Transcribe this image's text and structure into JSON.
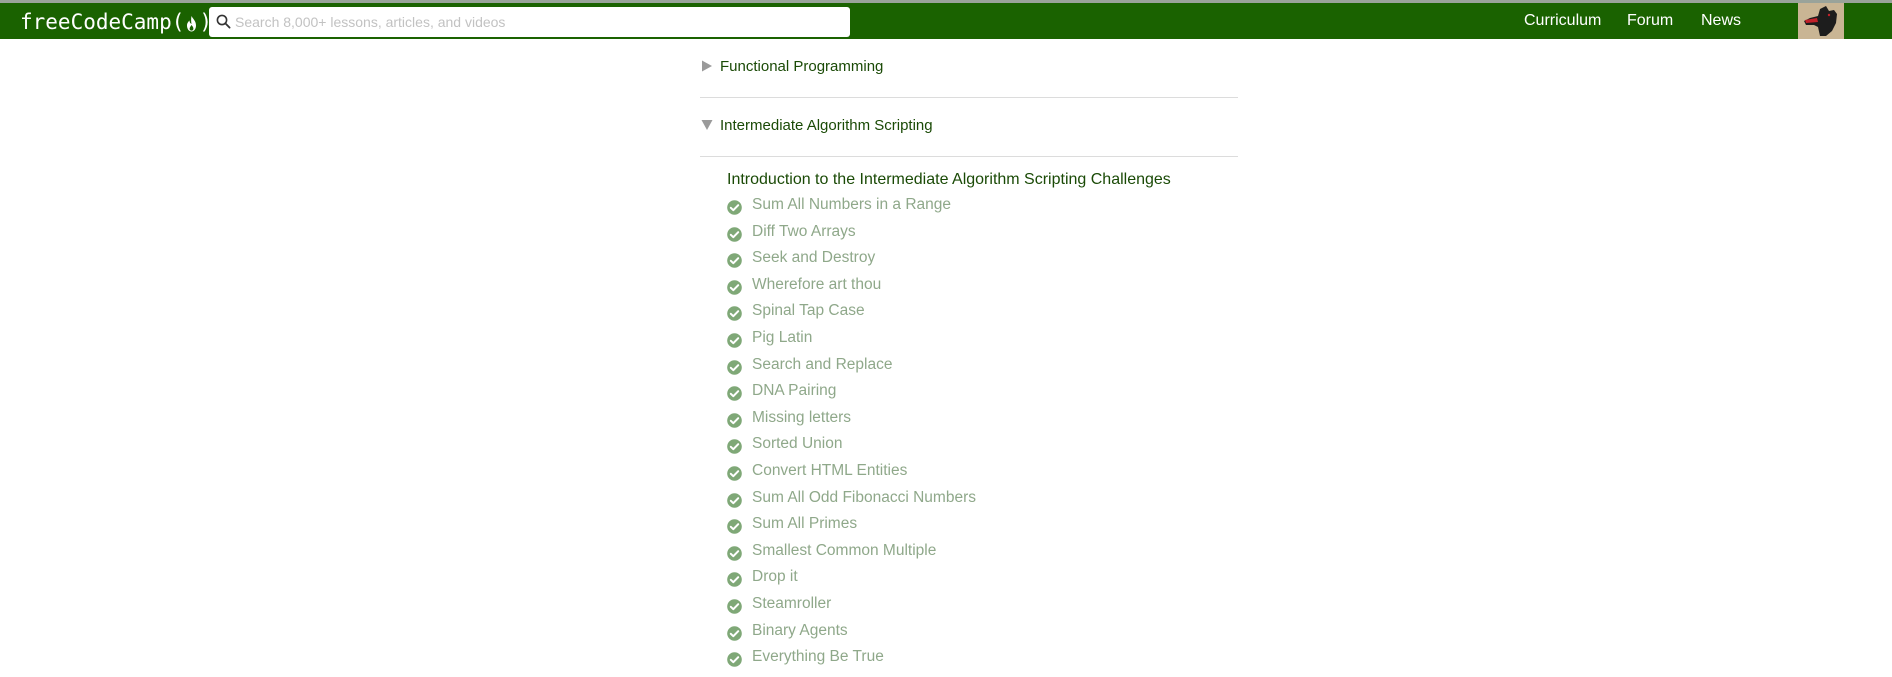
{
  "header": {
    "logo_text_left": "freeCodeCamp(",
    "logo_text_right": ")",
    "search_placeholder": "Search 8,000+ lessons, articles, and videos",
    "nav_links": [
      {
        "label": "Curriculum"
      },
      {
        "label": "Forum"
      },
      {
        "label": "News"
      }
    ]
  },
  "blocks": [
    {
      "title": "Functional Programming",
      "expanded": false
    },
    {
      "title": "Intermediate Algorithm Scripting",
      "expanded": true
    }
  ],
  "intro_link": "Introduction to the Intermediate Algorithm Scripting Challenges",
  "challenges": [
    {
      "label": "Sum All Numbers in a Range",
      "completed": true
    },
    {
      "label": "Diff Two Arrays",
      "completed": true
    },
    {
      "label": "Seek and Destroy",
      "completed": true
    },
    {
      "label": "Wherefore art thou",
      "completed": true
    },
    {
      "label": "Spinal Tap Case",
      "completed": true
    },
    {
      "label": "Pig Latin",
      "completed": true
    },
    {
      "label": "Search and Replace",
      "completed": true
    },
    {
      "label": "DNA Pairing",
      "completed": true
    },
    {
      "label": "Missing letters",
      "completed": true
    },
    {
      "label": "Sorted Union",
      "completed": true
    },
    {
      "label": "Convert HTML Entities",
      "completed": true
    },
    {
      "label": "Sum All Odd Fibonacci Numbers",
      "completed": true
    },
    {
      "label": "Sum All Primes",
      "completed": true
    },
    {
      "label": "Smallest Common Multiple",
      "completed": true
    },
    {
      "label": "Drop it",
      "completed": true
    },
    {
      "label": "Steamroller",
      "completed": true
    },
    {
      "label": "Binary Agents",
      "completed": true
    },
    {
      "label": "Everything Be True",
      "completed": true
    }
  ],
  "colors": {
    "navbar": "#1a6200",
    "link_dark_green": "#1a4a06",
    "completed_text": "#8fa88a",
    "check_green": "#7fa877"
  }
}
